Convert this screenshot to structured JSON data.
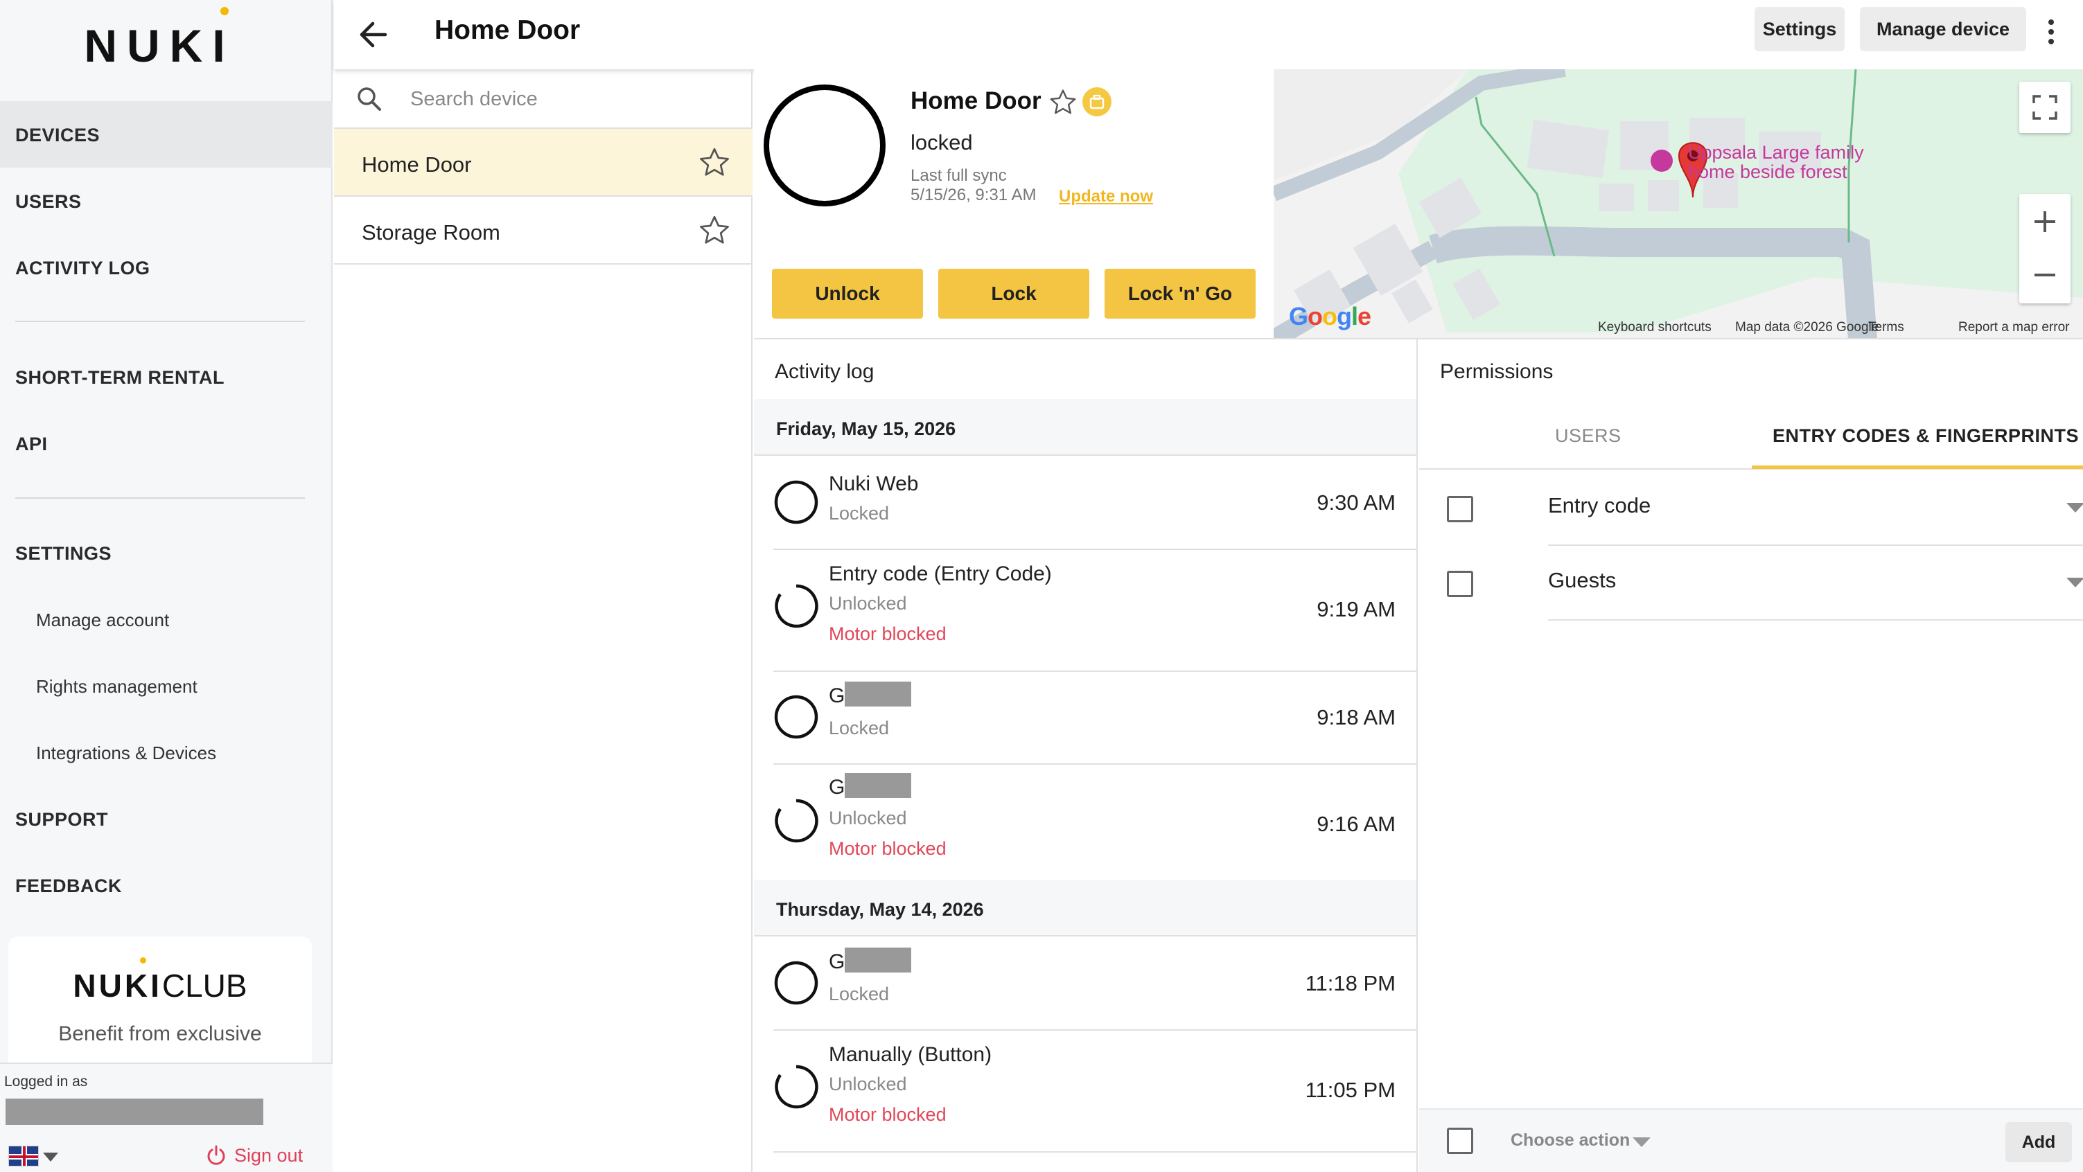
{
  "brand": {
    "logo_text": "NUKI",
    "accent": "#f4c542"
  },
  "sidebar": {
    "primary": [
      {
        "label": "DEVICES",
        "active": true
      },
      {
        "label": "USERS"
      },
      {
        "label": "ACTIVITY LOG"
      }
    ],
    "secondary": [
      {
        "label": "SHORT-TERM RENTAL"
      },
      {
        "label": "API"
      }
    ],
    "settings": {
      "label": "SETTINGS",
      "items": [
        "Manage account",
        "Rights management",
        "Integrations & Devices"
      ]
    },
    "support": "SUPPORT",
    "feedback": "FEEDBACK",
    "club": {
      "title_bold": "NUKI",
      "title_light": "CLUB",
      "subtitle": "Benefit from exclusive"
    },
    "logged_in_label": "Logged in as",
    "sign_out": "Sign out"
  },
  "topbar": {
    "title": "Home Door",
    "settings": "Settings",
    "manage": "Manage device"
  },
  "device_list": {
    "search_placeholder": "Search device",
    "devices": [
      {
        "name": "Home Door",
        "selected": true
      },
      {
        "name": "Storage Room",
        "selected": false
      }
    ]
  },
  "device": {
    "name": "Home Door",
    "state": "locked",
    "sync_label": "Last full sync",
    "sync_date": "5/15/26, 9:31 AM",
    "update_now": "Update now",
    "actions": [
      "Unlock",
      "Lock",
      "Lock 'n' Go"
    ]
  },
  "map": {
    "place": [
      "Uppsala Large family",
      "home beside forest"
    ],
    "logo": "Google",
    "footer": [
      "Keyboard shortcuts",
      "Map data ©2026 Google",
      "Terms",
      "Report a map error"
    ]
  },
  "activity_log": {
    "title": "Activity log",
    "days": [
      {
        "date": "Friday, May 15, 2026",
        "entries": [
          {
            "who": "Nuki Web",
            "action": "Locked",
            "warning": "",
            "time": "9:30 AM"
          },
          {
            "who": "Entry code (Entry Code)",
            "action": "Unlocked",
            "warning": "Motor blocked",
            "time": "9:19 AM"
          },
          {
            "who": "G",
            "action": "Locked",
            "warning": "",
            "time": "9:18 AM"
          },
          {
            "who": "G",
            "action": "Unlocked",
            "warning": "Motor blocked",
            "time": "9:16 AM"
          }
        ]
      },
      {
        "date": "Thursday, May 14, 2026",
        "entries": [
          {
            "who": "G",
            "action": "Locked",
            "warning": "",
            "time": "11:18 PM"
          },
          {
            "who": "Manually (Button)",
            "action": "Unlocked",
            "warning": "Motor blocked",
            "time": "11:05 PM"
          }
        ]
      }
    ]
  },
  "permissions": {
    "title": "Permissions",
    "tabs": [
      {
        "label": "USERS",
        "active": false
      },
      {
        "label": "ENTRY CODES & FINGERPRINTS",
        "active": true
      }
    ],
    "groups": [
      "Entry code",
      "Guests"
    ],
    "choose_action": "Choose action",
    "add": "Add"
  }
}
